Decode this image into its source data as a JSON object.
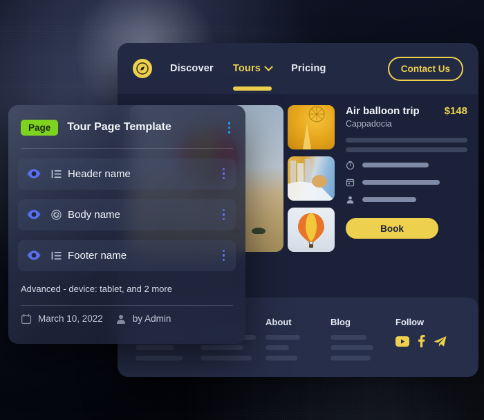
{
  "navbar": {
    "logo_icon": "compass-icon",
    "links": [
      {
        "label": "Discover",
        "active": false,
        "has_chevron": false
      },
      {
        "label": "Tours",
        "active": true,
        "has_chevron": true
      },
      {
        "label": "Pricing",
        "active": false,
        "has_chevron": false
      }
    ],
    "contact_button": "Contact Us"
  },
  "detail": {
    "title": "Air balloon trip",
    "price": "$148",
    "location": "Cappadocia",
    "book_button": "Book",
    "meta_icons": [
      "clock-icon",
      "calendar-icon",
      "person-icon"
    ]
  },
  "thumbnails": [
    {
      "name": "balloon-interior-thumbnail"
    },
    {
      "name": "balloon-sky-thumbnail"
    },
    {
      "name": "orange-balloon-thumbnail"
    }
  ],
  "hero": {
    "name": "hot-air-balloon-hero-image"
  },
  "footer": {
    "columns": [
      {
        "title": "",
        "bars": 3
      },
      {
        "title": "",
        "bars": 3
      },
      {
        "title": "About",
        "bars": 3
      },
      {
        "title": "Blog",
        "bars": 3
      }
    ],
    "follow_title": "Follow",
    "socials": [
      "youtube-icon",
      "facebook-icon",
      "telegram-icon"
    ]
  },
  "card": {
    "badge": "Page",
    "title": "Tour Page Template",
    "rows": [
      {
        "label": "Header name",
        "type_icon": "list-icon",
        "visibility_icon": "eye-icon"
      },
      {
        "label": "Body name",
        "type_icon": "gutenberg-target-icon",
        "visibility_icon": "eye-icon"
      },
      {
        "label": "Footer name",
        "type_icon": "list-icon",
        "visibility_icon": "eye-icon"
      }
    ],
    "advanced": "Advanced - device: tablet, and 2 more",
    "date": "March 10, 2022",
    "author": "by Admin"
  },
  "colors": {
    "accent_yellow": "#edd04e",
    "badge_green": "#7ed321",
    "kebab_blue": "#1e9bf0",
    "eye_indigo": "#5b6ef0",
    "panel_navy": "#1b2138",
    "navbar_navy": "#222942",
    "footer_navy": "#262e49"
  }
}
